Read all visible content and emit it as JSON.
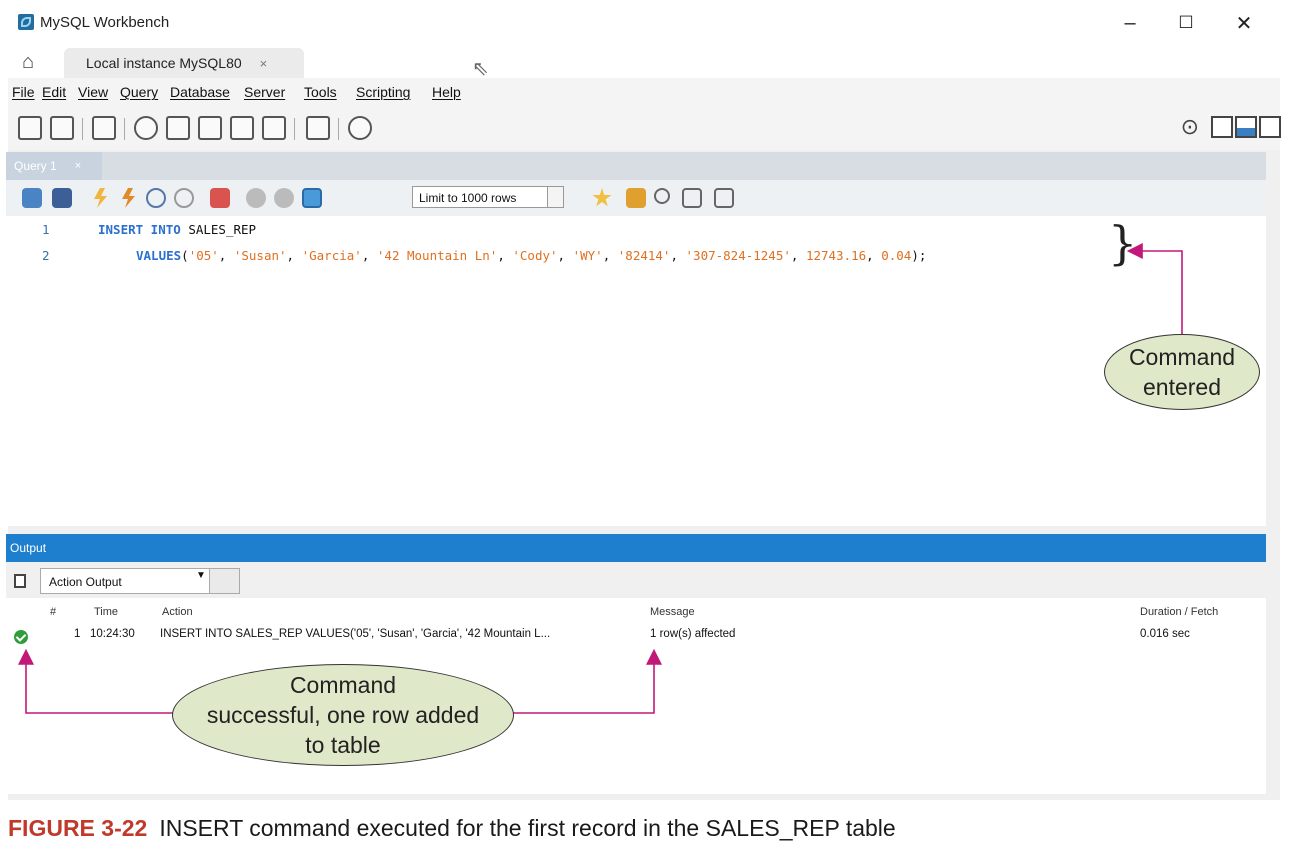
{
  "window": {
    "title": "MySQL Workbench",
    "minimize": "–",
    "maximize": "☐",
    "close": "✕"
  },
  "connection_tab": {
    "label": "Local instance MySQL80",
    "close": "×"
  },
  "menu": [
    "File",
    "Edit",
    "View",
    "Query",
    "Database",
    "Server",
    "Tools",
    "Scripting",
    "Help"
  ],
  "query_tab": {
    "label": "Query 1",
    "close": "×"
  },
  "query_toolbar": {
    "limit_select": "Limit to 1000 rows"
  },
  "editor": {
    "line_numbers": [
      "1",
      "2"
    ],
    "line1": {
      "kw": "INSERT INTO",
      "table": " SALES_REP"
    },
    "line2": {
      "kw": "VALUES",
      "open": "(",
      "args": [
        "'05'",
        "'Susan'",
        "'Garcia'",
        "'42 Mountain Ln'",
        "'Cody'",
        "'WY'",
        "'82414'",
        "'307-824-1245'",
        "12743.16",
        "0.04"
      ],
      "close": ");"
    }
  },
  "output": {
    "header": "Output",
    "selector": "Action Output",
    "columns": [
      "#",
      "Time",
      "Action",
      "Message",
      "Duration / Fetch"
    ],
    "rows": [
      {
        "num": "1",
        "time": "10:24:30",
        "action": "INSERT INTO SALES_REP VALUES('05', 'Susan', 'Garcia', '42 Mountain L...",
        "message": "1 row(s) affected",
        "duration": "0.016 sec",
        "status": "success"
      }
    ]
  },
  "callouts": {
    "command_entered": [
      "Command",
      "entered"
    ],
    "command_successful": [
      "Command",
      "successful, one row added",
      "to table"
    ]
  },
  "caption": {
    "figure": "FIGURE 3-22",
    "text": "INSERT command executed for the first record in the SALES_REP table"
  },
  "colors": {
    "accent_blue": "#1e7fcf",
    "callout_fill": "#dfe8c8",
    "arrow": "#c2187a",
    "figure_label": "#c0392b"
  }
}
